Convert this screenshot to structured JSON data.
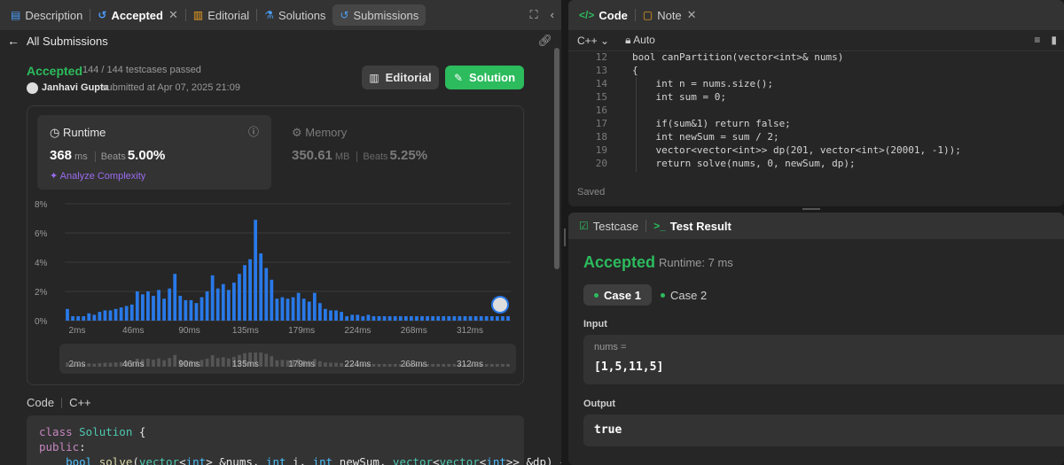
{
  "left_tabs": [
    {
      "label": "Description",
      "icon": "description-icon"
    },
    {
      "label": "Accepted",
      "icon": "history-icon"
    },
    {
      "label": "Editorial",
      "icon": "book-icon"
    },
    {
      "label": "Solutions",
      "icon": "flask-icon"
    },
    {
      "label": "Submissions",
      "icon": "history-icon"
    }
  ],
  "back_label": "All Submissions",
  "submission": {
    "status": "Accepted",
    "testcases": "144 / 144 testcases passed",
    "user": "Janhavi Gupta",
    "submitted": "submitted at Apr 07, 2025 21:09",
    "editorial_btn": "Editorial",
    "solution_btn": "Solution"
  },
  "runtime": {
    "title": "Runtime",
    "value": "368",
    "unit": "ms",
    "beats_label": "Beats",
    "beats_pct": "5.00%",
    "analyze": "Analyze Complexity"
  },
  "memory": {
    "title": "Memory",
    "value": "350.61",
    "unit": "MB",
    "beats_label": "Beats",
    "beats_pct": "5.25%"
  },
  "chart_data": {
    "type": "bar",
    "y_ticks": [
      "8%",
      "6%",
      "4%",
      "2%",
      "0%"
    ],
    "ylim": [
      0,
      8
    ],
    "x_ticks": [
      "2ms",
      "46ms",
      "90ms",
      "135ms",
      "179ms",
      "224ms",
      "268ms",
      "312ms"
    ],
    "values": [
      0.8,
      0.3,
      0.3,
      0.3,
      0.5,
      0.4,
      0.6,
      0.7,
      0.7,
      0.8,
      0.9,
      1.0,
      1.1,
      2.0,
      1.8,
      2.0,
      1.7,
      2.1,
      1.5,
      2.2,
      3.2,
      1.7,
      1.4,
      1.4,
      1.2,
      1.6,
      2.0,
      3.1,
      2.2,
      2.5,
      2.1,
      2.6,
      3.2,
      3.8,
      4.2,
      6.9,
      4.6,
      3.6,
      2.8,
      1.5,
      1.6,
      1.5,
      1.6,
      1.9,
      1.5,
      1.3,
      1.9,
      1.2,
      0.8,
      0.7,
      0.7,
      0.6,
      0.3,
      0.4,
      0.4,
      0.3,
      0.4,
      0.3,
      0.3,
      0.3,
      0.3,
      0.3,
      0.3,
      0.3,
      0.3,
      0.3,
      0.3,
      0.3,
      0.3,
      0.3,
      0.3,
      0.3,
      0.3,
      0.3,
      0.3,
      0.3,
      0.3,
      0.3,
      0.3,
      0.3,
      0.3,
      0.3,
      0.3
    ],
    "grid": true,
    "bar_color": "#2979e8"
  },
  "code_panel": {
    "label": "Code",
    "lang": "C++",
    "lines": [
      [
        [
          "class ",
          "kw"
        ],
        [
          "Solution",
          "cls"
        ],
        [
          " {",
          "pl"
        ]
      ],
      [
        [
          "public",
          "kw"
        ],
        [
          ":",
          "pl"
        ]
      ],
      [
        [
          "    ",
          "pl"
        ],
        [
          "bool",
          "ty"
        ],
        [
          " ",
          "pl"
        ],
        [
          "solve",
          "fn"
        ],
        [
          "(",
          "pl"
        ],
        [
          "vector",
          "cls"
        ],
        [
          "<",
          "pl"
        ],
        [
          "int",
          "ty"
        ],
        [
          "> &nums, ",
          "pl"
        ],
        [
          "int",
          "ty"
        ],
        [
          " i, ",
          "pl"
        ],
        [
          "int",
          "ty"
        ],
        [
          " newSum, ",
          "pl"
        ],
        [
          "vector",
          "cls"
        ],
        [
          "<",
          "pl"
        ],
        [
          "vector",
          "cls"
        ],
        [
          "<",
          "pl"
        ],
        [
          "int",
          "ty"
        ],
        [
          ">> &dp) {",
          "pl"
        ]
      ]
    ]
  },
  "editor": {
    "tabs": [
      {
        "label": "Code",
        "icon": "code-icon"
      },
      {
        "label": "Note",
        "icon": "note-icon"
      }
    ],
    "lang": "C++",
    "auto": "Auto",
    "saved": "Saved",
    "lines": [
      {
        "no": "12",
        "text": "bool canPartition(vector<int>& nums)"
      },
      {
        "no": "13",
        "text": "{"
      },
      {
        "no": "14",
        "text": "    int n = nums.size();"
      },
      {
        "no": "15",
        "text": "    int sum = 0;"
      },
      {
        "no": "16",
        "text": ""
      },
      {
        "no": "17",
        "text": "    if(sum&1) return false;"
      },
      {
        "no": "18",
        "text": "    int newSum = sum / 2;"
      },
      {
        "no": "19",
        "text": "    vector<vector<int>> dp(201, vector<int>(20001, -1));"
      },
      {
        "no": "20",
        "text": "    return solve(nums, 0, newSum, dp);"
      }
    ]
  },
  "result": {
    "tab_testcase": "Testcase",
    "tab_result": "Test Result",
    "title": "Accepted",
    "runtime": "Runtime: 7 ms",
    "cases": [
      "Case 1",
      "Case 2"
    ],
    "input_label": "Input",
    "input_name": "nums =",
    "input_value": "[1,5,11,5]",
    "output_label": "Output",
    "output_value": "true"
  },
  "colors": {
    "accent_green": "#2cbb5d",
    "bar_blue": "#2979e8",
    "analyze_purple": "#9b6cf0"
  }
}
